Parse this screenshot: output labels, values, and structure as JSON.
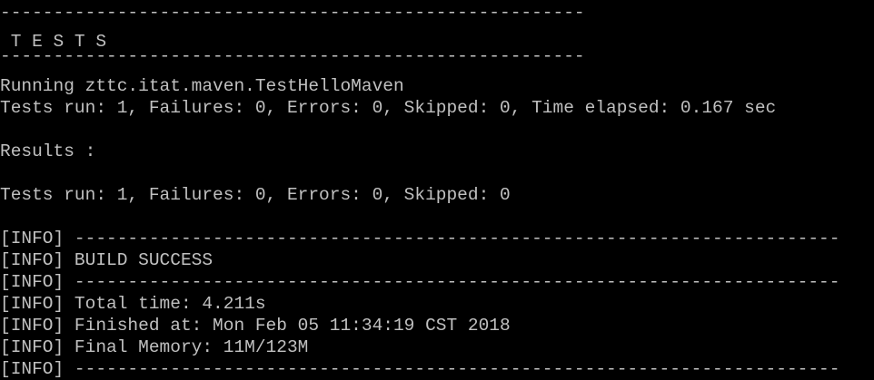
{
  "colors": {
    "background": "#000000",
    "foreground": "#c0c0c0"
  },
  "console": {
    "lines": [
      {
        "text": "-------------------------------------------------------"
      },
      {
        "text": " T E S T S"
      },
      {
        "text": "-------------------------------------------------------"
      },
      {
        "text": "Running zttc.itat.maven.TestHelloMaven"
      },
      {
        "text": "Tests run: 1, Failures: 0, Errors: 0, Skipped: 0, Time elapsed: 0.167 sec"
      },
      {
        "text": ""
      },
      {
        "text": "Results :"
      },
      {
        "text": ""
      },
      {
        "text": "Tests run: 1, Failures: 0, Errors: 0, Skipped: 0"
      },
      {
        "text": ""
      },
      {
        "tag": "[INFO]",
        "text": " ------------------------------------------------------------------------"
      },
      {
        "tag": "[INFO]",
        "text": " BUILD SUCCESS"
      },
      {
        "tag": "[INFO]",
        "text": " ------------------------------------------------------------------------"
      },
      {
        "tag": "[INFO]",
        "text": " Total time: 4.211s"
      },
      {
        "tag": "[INFO]",
        "text": " Finished at: Mon Feb 05 11:34:19 CST 2018"
      },
      {
        "tag": "[INFO]",
        "text": " Final Memory: 11M/123M"
      },
      {
        "tag": "[INFO]",
        "text": " ------------------------------------------------------------------------"
      }
    ]
  }
}
